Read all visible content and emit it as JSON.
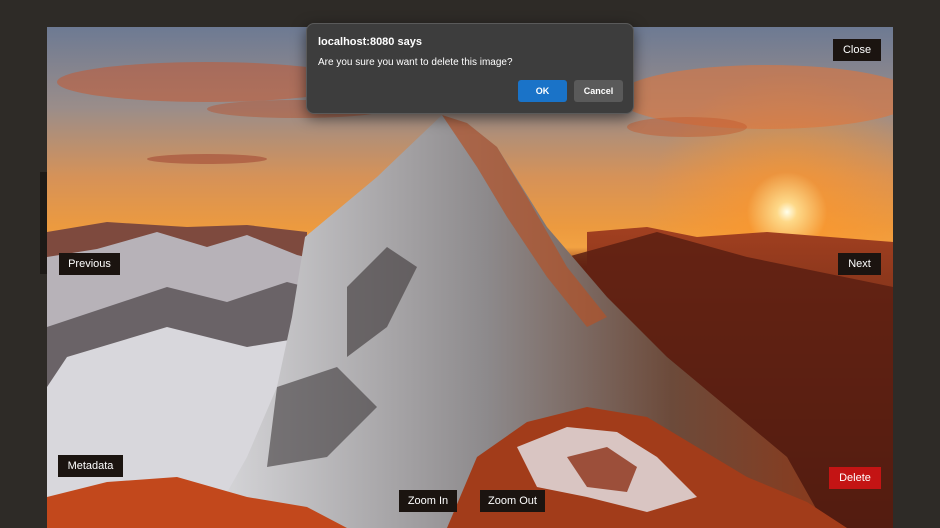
{
  "viewer": {
    "image_alt": "Snow-covered mountain peak at sunset",
    "close_label": "Close",
    "previous_label": "Previous",
    "next_label": "Next",
    "metadata_label": "Metadata",
    "delete_label": "Delete",
    "zoom_in_label": "Zoom In",
    "zoom_out_label": "Zoom Out"
  },
  "dialog": {
    "title": "localhost:8080 says",
    "message": "Are you sure you want to delete this image?",
    "ok_label": "OK",
    "cancel_label": "Cancel"
  },
  "colors": {
    "page_background": "#2e2b27",
    "delete_button": "#c41414",
    "ok_button": "#1a73c8",
    "dialog_background": "#3d3d3d"
  }
}
